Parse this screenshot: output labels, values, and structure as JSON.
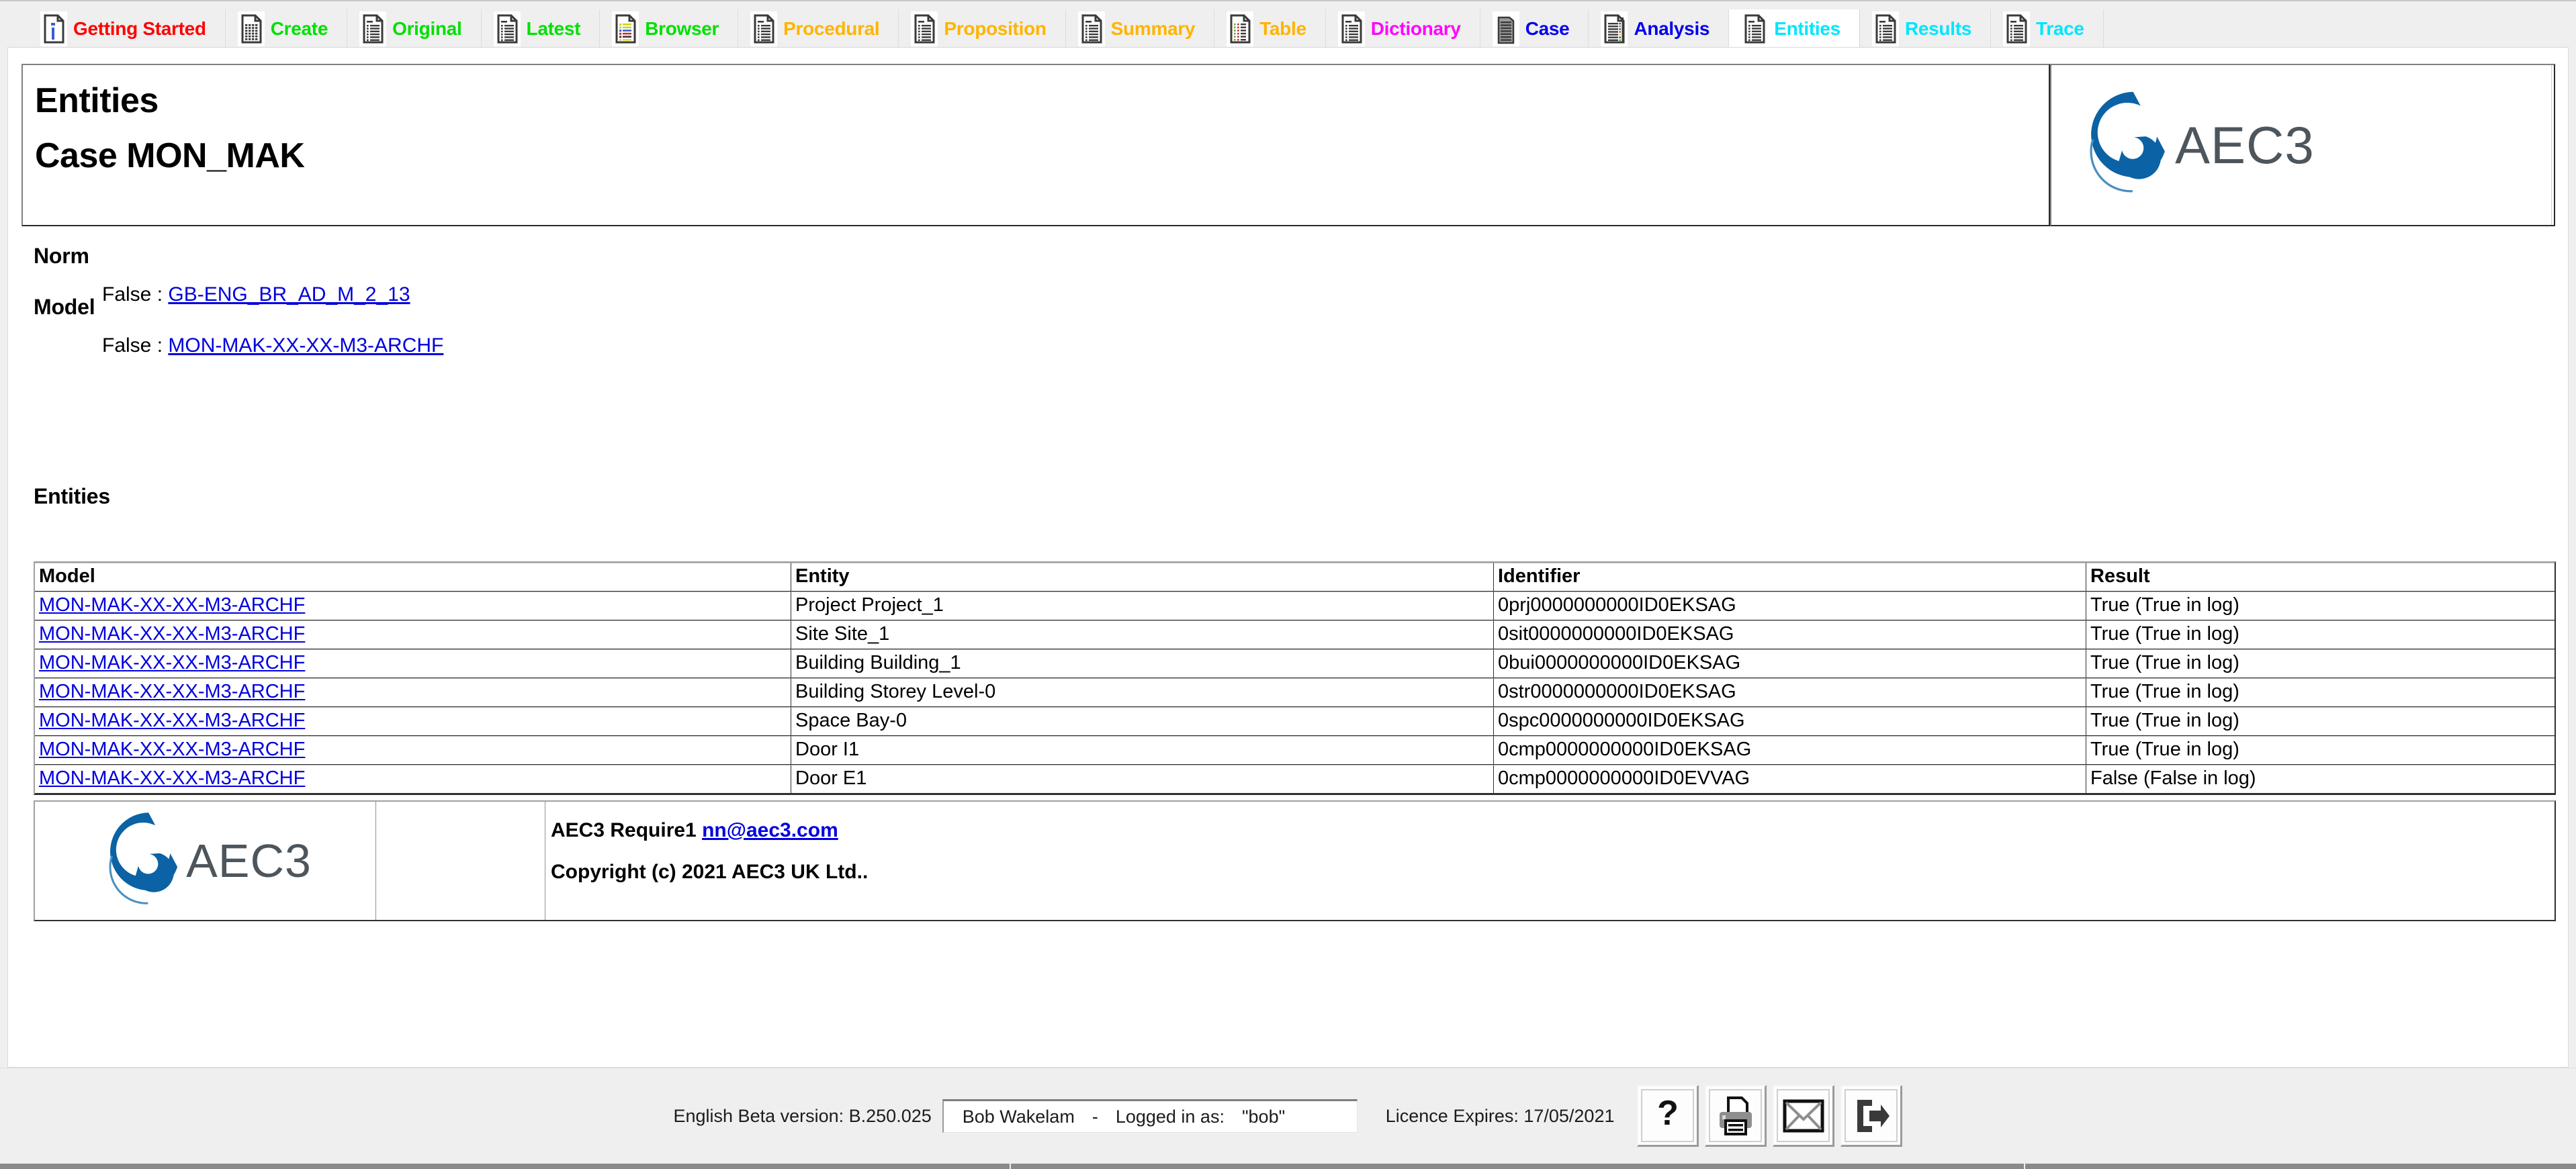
{
  "tabs": [
    {
      "label": "Getting Started",
      "color": "#ff0000",
      "icon": "info-document-icon"
    },
    {
      "label": "Create",
      "color": "#00e000",
      "icon": "grid-document-icon"
    },
    {
      "label": "Original",
      "color": "#00e000",
      "icon": "lines-document-icon"
    },
    {
      "label": "Latest",
      "color": "#00e000",
      "icon": "lines-document-icon"
    },
    {
      "label": "Browser",
      "color": "#00e000",
      "icon": "colored-list-document-icon"
    },
    {
      "label": "Procedural",
      "color": "#ffb400",
      "icon": "lines-document-icon"
    },
    {
      "label": "Proposition",
      "color": "#ffb400",
      "icon": "lines-document-icon"
    },
    {
      "label": "Summary",
      "color": "#ffb400",
      "icon": "lines-document-icon"
    },
    {
      "label": "Table",
      "color": "#ffb400",
      "icon": "dotted-table-document-icon"
    },
    {
      "label": "Dictionary",
      "color": "#ff00ff",
      "icon": "lines-document-icon"
    },
    {
      "label": "Case",
      "color": "#0000ee",
      "icon": "building-icon"
    },
    {
      "label": "Analysis",
      "color": "#0000ee",
      "icon": "analysis-document-icon"
    },
    {
      "label": "Entities",
      "color": "#00e5ff",
      "icon": "lines-document-icon",
      "active": true
    },
    {
      "label": "Results",
      "color": "#00e5ff",
      "icon": "lines-document-icon"
    },
    {
      "label": "Trace",
      "color": "#00e5ff",
      "icon": "lines-document-icon"
    }
  ],
  "header": {
    "title": "Entities",
    "case_title": "Case MON_MAK",
    "logo_text": "AEC3"
  },
  "norm": {
    "heading": "Norm",
    "value_prefix": "False : ",
    "link": "GB-ENG_BR_AD_M_2_13"
  },
  "model": {
    "heading": "Model",
    "value_prefix": "False : ",
    "link": "MON-MAK-XX-XX-M3-ARCHF"
  },
  "entities": {
    "heading": "Entities",
    "columns": [
      "Model",
      "Entity",
      "Identifier",
      "Result"
    ],
    "rows": [
      {
        "model": "MON-MAK-XX-XX-M3-ARCHF",
        "entity": "Project Project_1",
        "identifier": "0prj0000000000ID0EKSAG",
        "result": "True (True in log)",
        "align": "left"
      },
      {
        "model": "MON-MAK-XX-XX-M3-ARCHF",
        "entity": "Site Site_1",
        "identifier": "0sit0000000000ID0EKSAG",
        "result": "True (True in log)",
        "align": "left"
      },
      {
        "model": "MON-MAK-XX-XX-M3-ARCHF",
        "entity": "Building Building_1",
        "identifier": "0bui0000000000ID0EKSAG",
        "result": "True (True in log)",
        "align": "left"
      },
      {
        "model": "MON-MAK-XX-XX-M3-ARCHF",
        "entity": "Building Storey Level-0",
        "identifier": "0str0000000000ID0EKSAG",
        "result": "True (True in log)",
        "align": "left"
      },
      {
        "model": "MON-MAK-XX-XX-M3-ARCHF",
        "entity": "Space Bay-0",
        "identifier": "0spc0000000000ID0EKSAG",
        "result": "True (True in log)",
        "align": "left"
      },
      {
        "model": "MON-MAK-XX-XX-M3-ARCHF",
        "entity": "Door I1",
        "identifier": "0cmp0000000000ID0EKSAG",
        "result": "True (True in log)",
        "align": "left"
      },
      {
        "model": "MON-MAK-XX-XX-M3-ARCHF",
        "entity": "Door E1",
        "identifier": "0cmp0000000000ID0EVVAG",
        "result": "False (False in log)",
        "align": "right"
      }
    ]
  },
  "footer": {
    "logo_text": "AEC3",
    "product_prefix": "AEC3 Require1 ",
    "email": "nn@aec3.com",
    "copyright": "Copyright (c) 2021 AEC3 UK Ltd.."
  },
  "status": {
    "version": "English Beta version: B.250.025",
    "user_name": "Bob Wakelam",
    "separator": "-",
    "logged_in_label": "Logged in as:",
    "logged_in_value": "\"bob\"",
    "licence": "Licence Expires: 17/05/2021",
    "buttons": [
      {
        "name": "help-button",
        "icon": "question-mark-icon"
      },
      {
        "name": "print-button",
        "icon": "printer-icon"
      },
      {
        "name": "email-button",
        "icon": "envelope-icon"
      },
      {
        "name": "logout-button",
        "icon": "exit-arrow-icon"
      }
    ]
  },
  "colors": {
    "brand_blue": "#0b62a4",
    "brand_gray": "#4d565c",
    "link": "#0000dd",
    "chrome": "#efefef"
  }
}
